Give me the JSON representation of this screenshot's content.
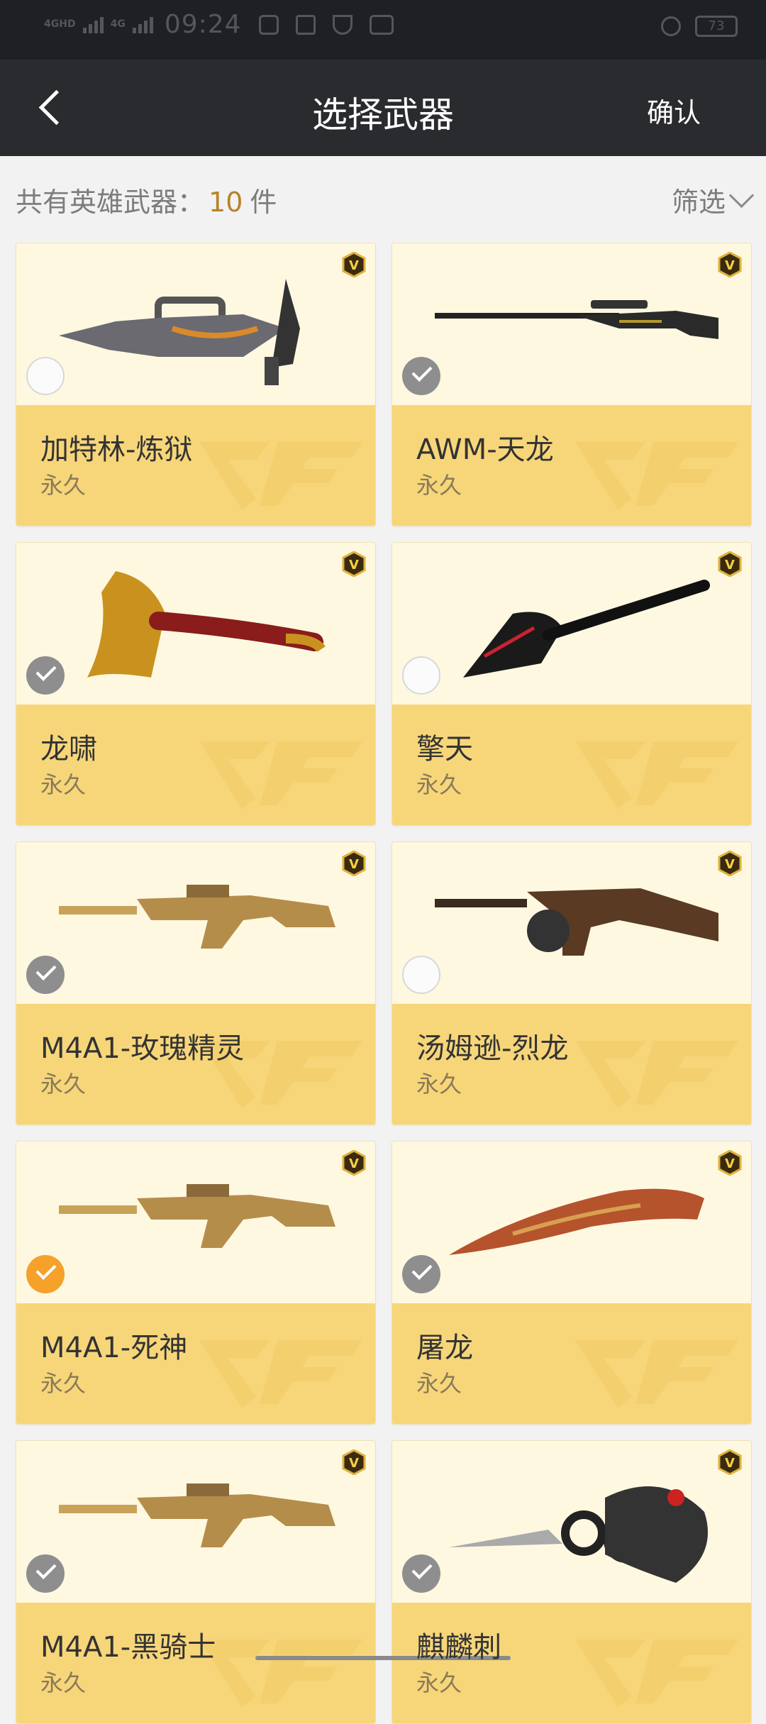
{
  "status_bar": {
    "network_1": "4GHD",
    "network_2": "4G",
    "time": "09:24",
    "icons": [
      "gallery-icon",
      "telegram-icon",
      "shield-icon",
      "dry-icon"
    ],
    "alarm_icon": "alarm-icon",
    "battery": "73"
  },
  "nav": {
    "back_icon": "chevron-left-icon",
    "title": "选择武器",
    "confirm_label": "确认"
  },
  "subheader": {
    "total_prefix": "共有英雄武器：",
    "total_count": "10",
    "total_unit": "件",
    "filter_label": "筛选"
  },
  "colors": {
    "nav_bg": "#2a2b2f",
    "card_top": "#fff8e1",
    "card_bottom": "#f7d67a",
    "accent_orange": "#f5a12a",
    "count_color": "#b8822a"
  },
  "weapons": [
    {
      "name": "加特林-炼狱",
      "duration": "永久",
      "state": "empty",
      "icon": "gatling-gun-icon"
    },
    {
      "name": "AWM-天龙",
      "duration": "永久",
      "state": "grey",
      "icon": "sniper-rifle-icon"
    },
    {
      "name": "龙啸",
      "duration": "永久",
      "state": "grey",
      "icon": "axe-icon"
    },
    {
      "name": "擎天",
      "duration": "永久",
      "state": "empty",
      "icon": "shovel-icon"
    },
    {
      "name": "M4A1-玫瑰精灵",
      "duration": "永久",
      "state": "grey",
      "icon": "rifle-icon"
    },
    {
      "name": "汤姆逊-烈龙",
      "duration": "永久",
      "state": "empty",
      "icon": "tommy-gun-icon"
    },
    {
      "name": "M4A1-死神",
      "duration": "永久",
      "state": "orange",
      "icon": "rifle-icon"
    },
    {
      "name": "屠龙",
      "duration": "永久",
      "state": "grey",
      "icon": "machete-icon"
    },
    {
      "name": "M4A1-黑骑士",
      "duration": "永久",
      "state": "grey",
      "icon": "rifle-icon"
    },
    {
      "name": "麒麟刺",
      "duration": "永久",
      "state": "grey",
      "icon": "knuckle-knife-icon"
    }
  ]
}
